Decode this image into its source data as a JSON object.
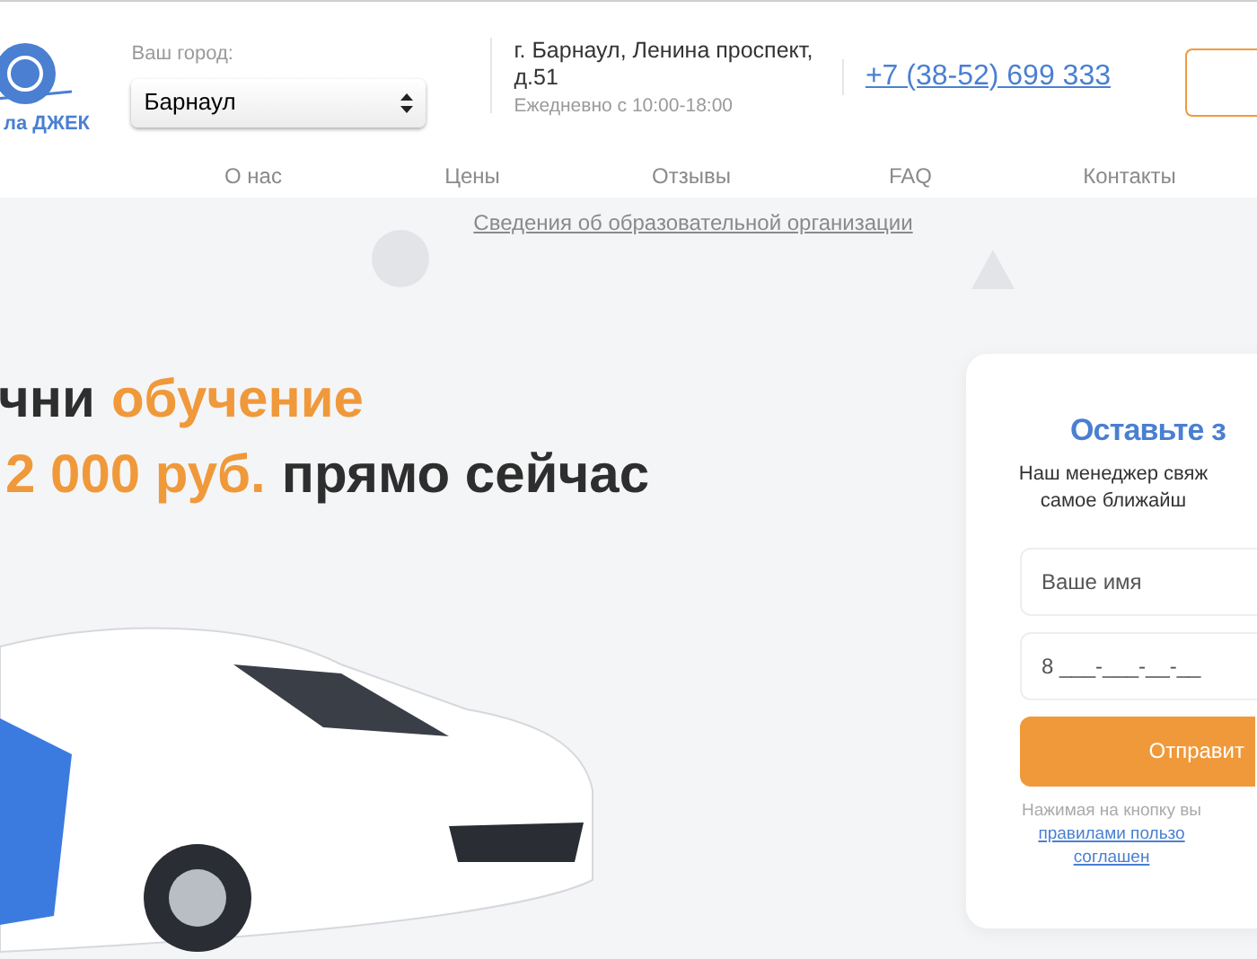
{
  "header": {
    "logo_text": "ла ДЖЕК",
    "city_label": "Ваш город:",
    "city_select": {
      "value": "Барнаул"
    },
    "address": "г. Барнаул, Ленина проспект, д.51",
    "hours": "Ежедневно с 10:00-18:00",
    "phone": "+7 (38-52) 699 333"
  },
  "nav": [
    "О нас",
    "Цены",
    "Отзывы",
    "FAQ",
    "Контакты"
  ],
  "info_link": "Сведения об образовательной организации",
  "headline": [
    [
      {
        "text": "чни",
        "accent": false
      },
      {
        "text": "обучение",
        "accent": true
      }
    ],
    [
      {
        "text": "2 000 руб.",
        "accent": true
      },
      {
        "text": "прямо сейчас",
        "accent": false
      }
    ]
  ],
  "form": {
    "title": "Оставьте з",
    "subtitle": [
      "Наш менеджер свяж",
      "самое ближайш"
    ],
    "name_field": {
      "placeholder": "Ваше имя"
    },
    "phone_field": {
      "placeholder": "8 ___-___-__-__"
    },
    "submit": "Отправит",
    "note": "Нажимая на кнопку вы",
    "links": [
      "правилами пользо",
      "соглашен"
    ]
  }
}
